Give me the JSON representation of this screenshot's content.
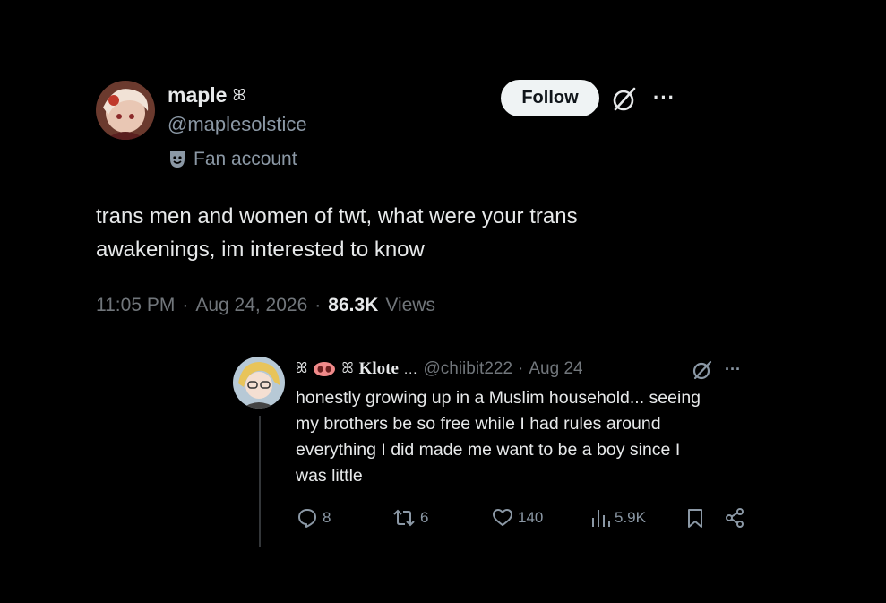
{
  "tweet": {
    "author_name": "maple",
    "author_name_emoji": "ꕤ",
    "handle": "@maplesolstice",
    "badge_label": "Fan account",
    "follow_label": "Follow",
    "more_label": "···",
    "text_line1": "trans men and women of twt, what were your trans",
    "text_line2": "awakenings, im interested to know",
    "time": "11:05 PM",
    "date": "Aug 24, 2026",
    "views_count": "86.3K",
    "views_label": "Views",
    "separator": "·"
  },
  "reply": {
    "name_prefix": "ꕤ",
    "name_suffix": "ꕤ",
    "name": "Klote",
    "name_dots": "...",
    "handle": "@chiibit222",
    "date": "Aug 24",
    "separator": "·",
    "more_label": "···",
    "text_line1": "honestly growing up in a Muslim household... seeing",
    "text_line2": "my brothers be so free while I had rules around",
    "text_line3": "everything I did made me want to be a boy since I",
    "text_line4": "was little",
    "replies": "8",
    "retweets": "6",
    "likes": "140",
    "views": "5.9K"
  },
  "colors": {
    "background": "#000000",
    "text": "#e7e9ea",
    "muted": "#71767b",
    "follow_bg": "#eff3f4"
  }
}
